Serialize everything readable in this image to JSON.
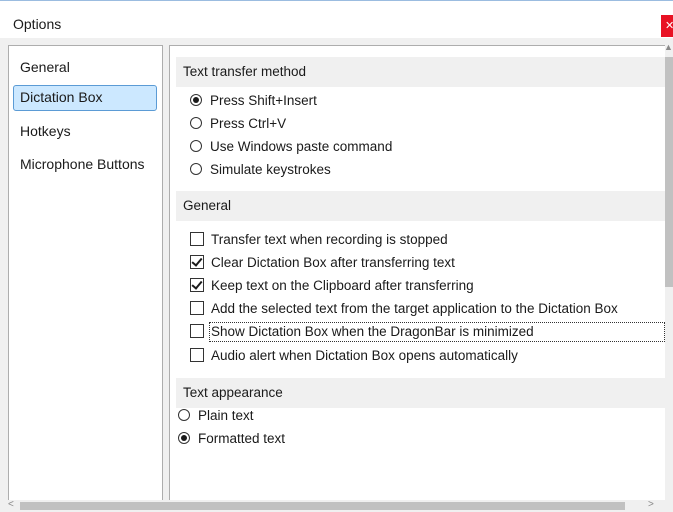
{
  "window": {
    "title": "Options",
    "close_glyph": "✕"
  },
  "nav": {
    "items": [
      {
        "label": "General",
        "selected": false
      },
      {
        "label": "Dictation Box",
        "selected": true
      },
      {
        "label": "Hotkeys",
        "selected": false
      },
      {
        "label": "Microphone Buttons",
        "selected": false
      }
    ]
  },
  "sections": {
    "transfer": {
      "title": "Text transfer method",
      "options": [
        {
          "label": "Press Shift+Insert",
          "checked": true
        },
        {
          "label": "Press Ctrl+V",
          "checked": false
        },
        {
          "label": "Use Windows paste command",
          "checked": false
        },
        {
          "label": "Simulate keystrokes",
          "checked": false
        }
      ]
    },
    "general": {
      "title": "General",
      "options": [
        {
          "label": "Transfer text when recording is stopped",
          "checked": false
        },
        {
          "label": "Clear Dictation Box after transferring text",
          "checked": true
        },
        {
          "label": "Keep text on the Clipboard after transferring",
          "checked": true
        },
        {
          "label": "Add the selected text from the target application to the Dictation Box",
          "checked": false
        },
        {
          "label": "Show Dictation Box when the DragonBar is minimized",
          "checked": false
        },
        {
          "label": "Audio alert when Dictation Box opens automatically",
          "checked": false
        }
      ]
    },
    "appearance": {
      "title": "Text appearance",
      "options": [
        {
          "label": "Plain text",
          "checked": false
        },
        {
          "label": "Formatted text",
          "checked": true
        }
      ]
    }
  },
  "scrollbars": {
    "up_arrow": "▲",
    "left_arrow": "<",
    "right_arrow": ">"
  }
}
